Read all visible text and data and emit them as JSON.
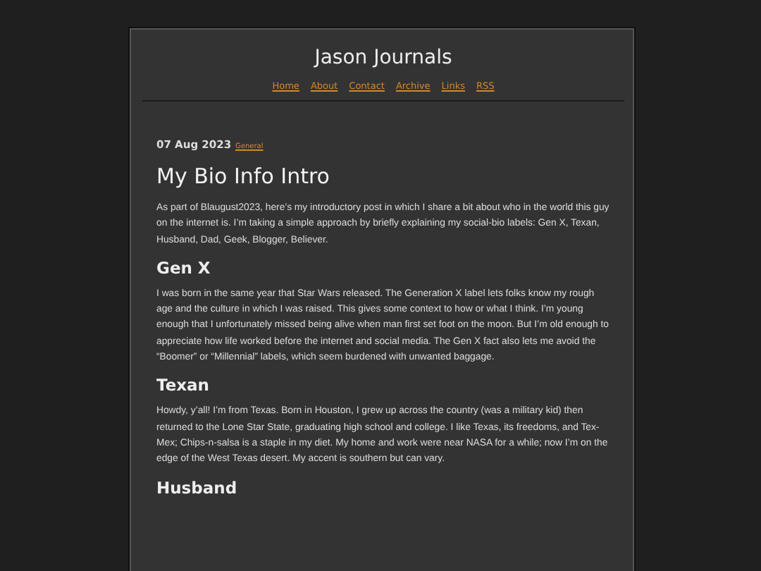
{
  "site": {
    "title": "Jason Journals",
    "nav": [
      {
        "label": "Home"
      },
      {
        "label": "About"
      },
      {
        "label": "Contact"
      },
      {
        "label": "Archive"
      },
      {
        "label": "Links"
      },
      {
        "label": "RSS"
      }
    ]
  },
  "post": {
    "date": "07 Aug 2023",
    "category": "General",
    "title": "My Bio Info Intro",
    "sections": [
      {
        "kind": "paragraph",
        "text": "As part of Blaugust2023, here’s my introductory post in which I share a bit about who in the world this guy on the internet is. I’m taking a simple approach by briefly explaining my social-bio labels: Gen X, Texan, Husband, Dad, Geek, Blogger, Believer."
      },
      {
        "kind": "heading",
        "text": "Gen X"
      },
      {
        "kind": "paragraph",
        "text": "I was born in the same year that Star Wars released. The Generation X label lets folks know my rough age and the culture in which I was raised. This gives some context to how or what I think. I’m young enough that I unfortunately missed being alive when man first set foot on the moon. But I’m old enough to appreciate how life worked before the internet and social media. The Gen X fact also lets me avoid the “Boomer” or “Millennial” labels, which seem burdened with unwanted baggage."
      },
      {
        "kind": "heading",
        "text": "Texan"
      },
      {
        "kind": "paragraph",
        "text": "Howdy, y’all! I’m from Texas. Born in Houston, I grew up across the country (was a military kid) then returned to the Lone Star State, graduating high school and college. I like Texas, its freedoms, and Tex-Mex; Chips-n-salsa is a staple in my diet. My home and work were near NASA for a while; now I’m on the edge of the West Texas desert. My accent is southern but can vary."
      },
      {
        "kind": "heading",
        "text": "Husband"
      }
    ]
  }
}
